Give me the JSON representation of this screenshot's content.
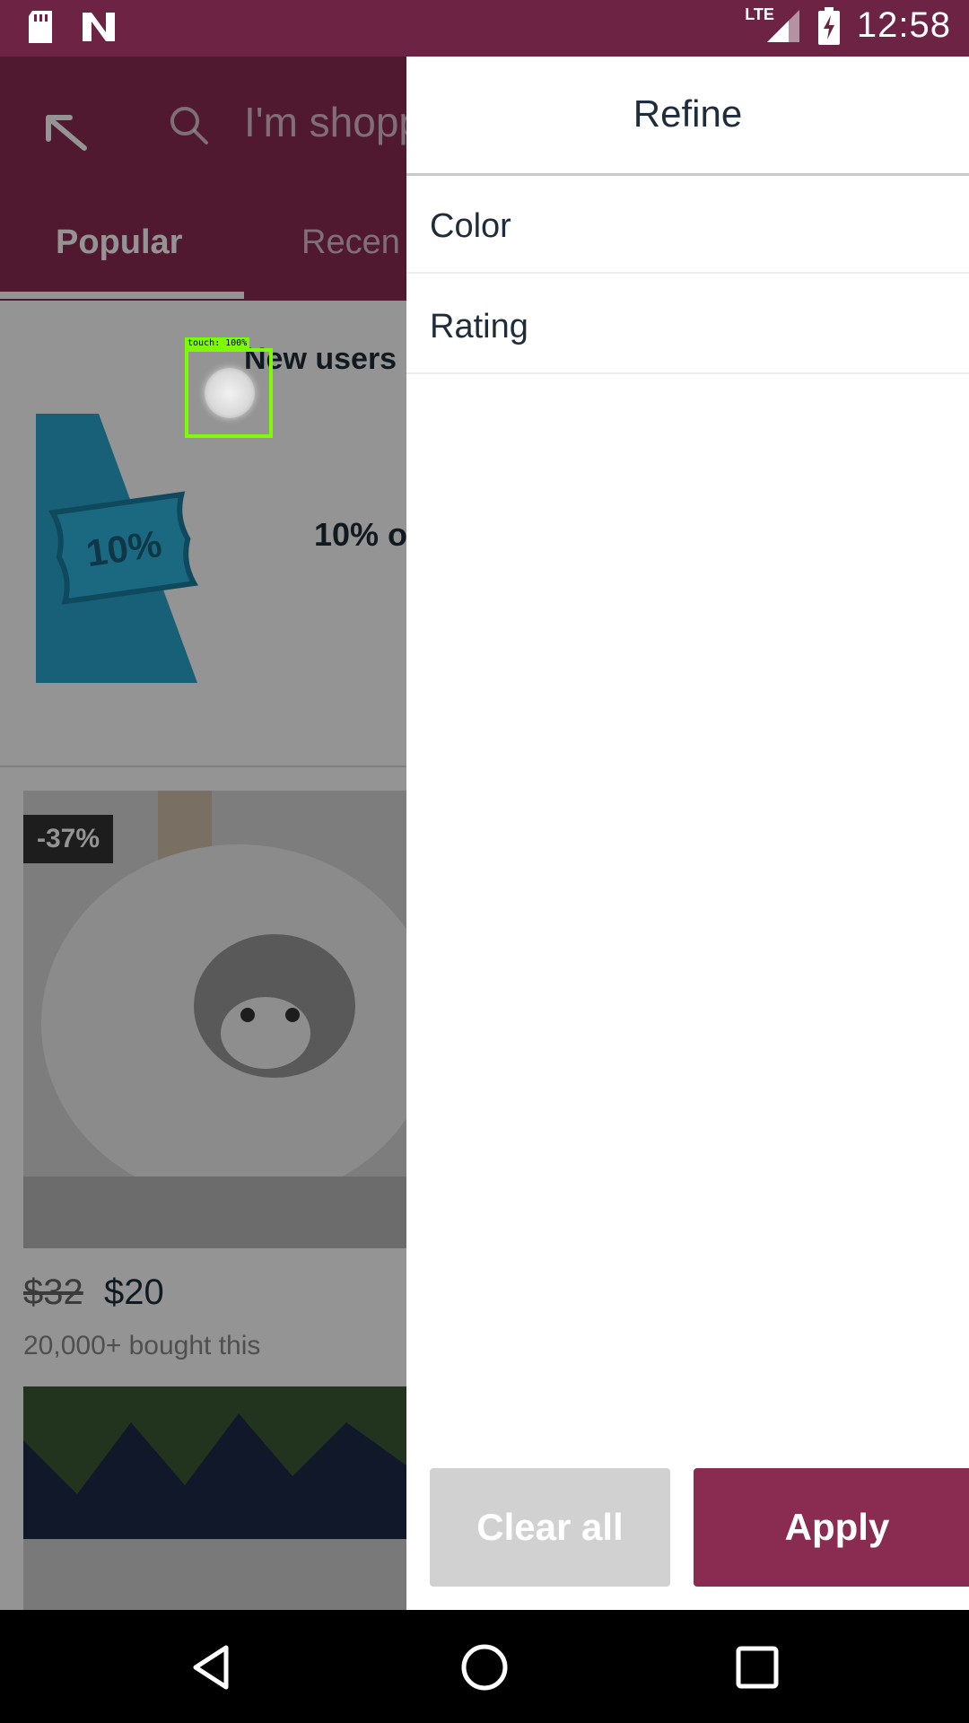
{
  "status_bar": {
    "network": "LTE",
    "time": "12:58",
    "icons": [
      "sd-card-icon",
      "n-logo-icon",
      "signal-icon",
      "battery-charging-icon"
    ]
  },
  "background_app": {
    "search_placeholder": "I'm shopp",
    "tabs": [
      "Popular",
      "Recen"
    ],
    "promo_title": "New users",
    "coupon_label": "10%",
    "promo_text": "10% o",
    "product": {
      "discount": "-37%",
      "price_old": "$32",
      "price_new": "$20",
      "bought": "20,000+ bought this"
    }
  },
  "touch_indicator": {
    "label": "touch: 100%"
  },
  "drawer": {
    "title": "Refine",
    "items": [
      "Color",
      "Rating"
    ],
    "clear_label": "Clear all",
    "apply_label": "Apply"
  },
  "colors": {
    "brand": "#8a2c52",
    "status_bar": "#6d2344",
    "clear_button": "#d1d1d1"
  }
}
